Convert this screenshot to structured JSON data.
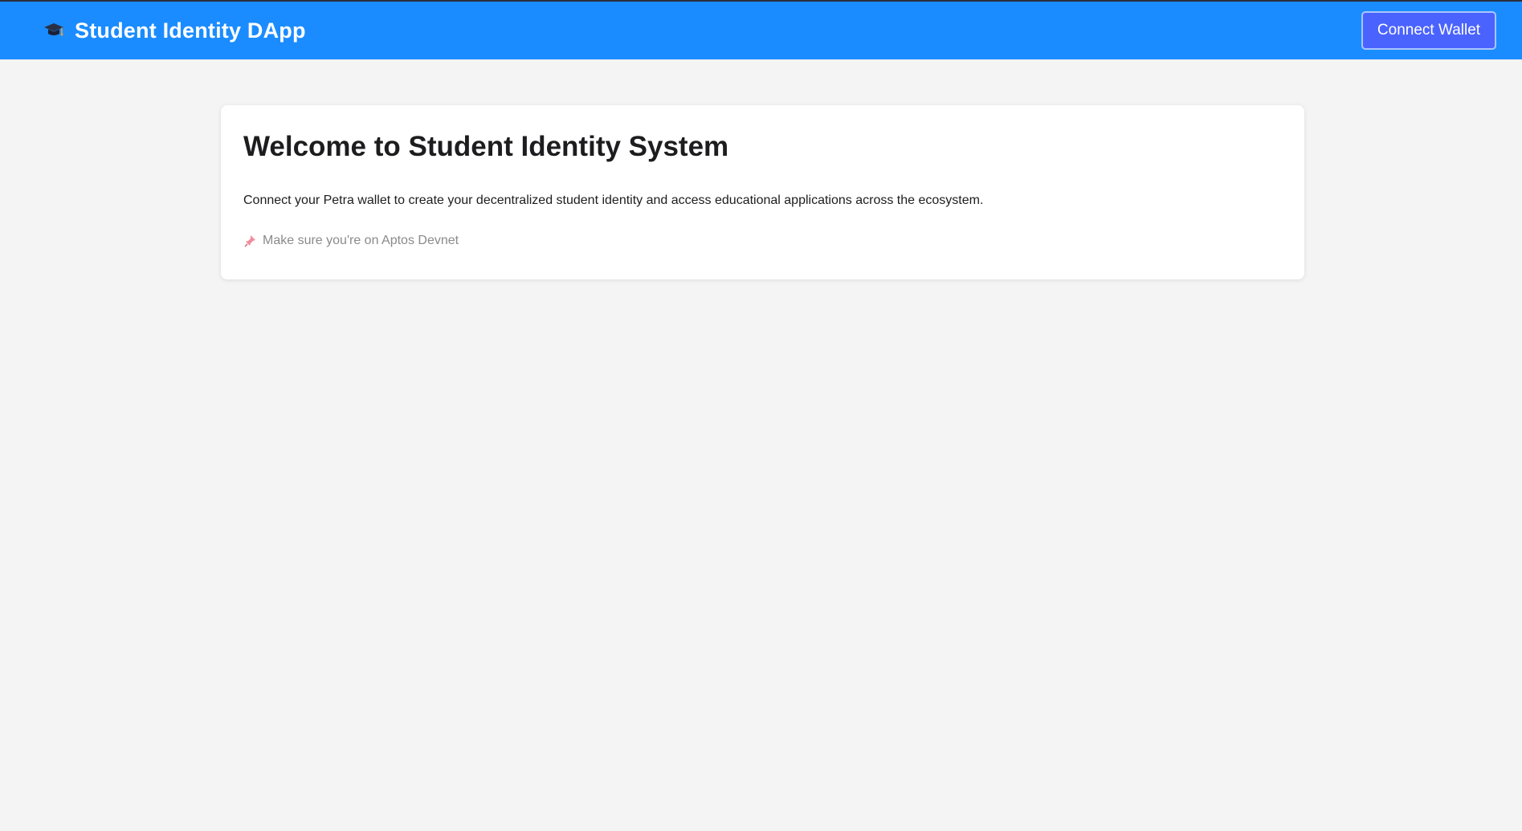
{
  "header": {
    "title": "Student Identity DApp",
    "icon": "graduation-cap-icon",
    "connect_label": "Connect Wallet",
    "colors": {
      "bar": "#1a8cff",
      "button": "#4a63ff"
    }
  },
  "welcome": {
    "title": "Welcome to Student Identity System",
    "description": "Connect your Petra wallet to create your decentralized student identity and access educational applications across the ecosystem.",
    "note_icon": "pushpin-icon",
    "note": "Make sure you're on Aptos Devnet"
  }
}
